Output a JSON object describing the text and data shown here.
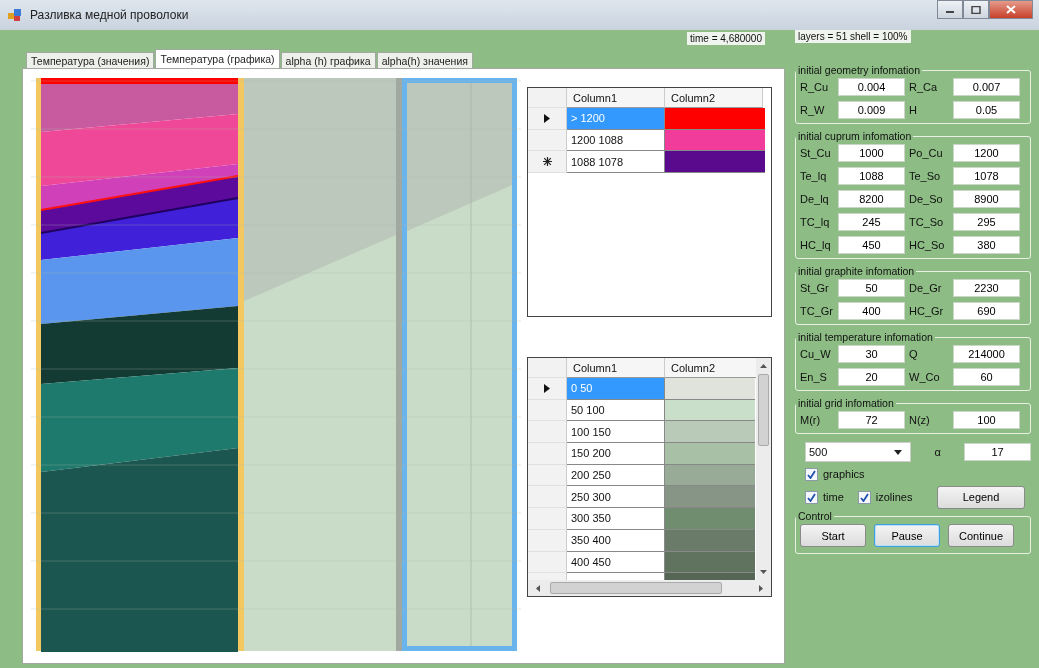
{
  "window": {
    "title": "Разливка медной проволоки"
  },
  "tabs": [
    {
      "label": "Температура (значения)",
      "selected": false
    },
    {
      "label": "Температура (графика)",
      "selected": true
    },
    {
      "label": "alpha (h) графика",
      "selected": false
    },
    {
      "label": "alpha(h) значения",
      "selected": false
    }
  ],
  "status": {
    "time": "time =  4,680000",
    "layers": "layers = 51 shell = 100%"
  },
  "legend_tables": [
    {
      "columns": [
        "Column1",
        "Column2"
      ],
      "scrollbars": false,
      "rows": [
        {
          "label": "> 1200",
          "color": "#ff0000",
          "selected": true,
          "current": true,
          "new_row": false
        },
        {
          "label": "1200 1088",
          "color": "#f23c9c",
          "selected": false,
          "current": false,
          "new_row": false
        },
        {
          "label": "1088 1078",
          "color": "#5a0a8c",
          "selected": false,
          "current": false,
          "new_row": true
        }
      ]
    },
    {
      "columns": [
        "Column1",
        "Column2"
      ],
      "scrollbars": true,
      "rows": [
        {
          "label": "0 50",
          "color": "#dfe3dc",
          "selected": true,
          "current": true,
          "new_row": false
        },
        {
          "label": "50 100",
          "color": "#cadfca",
          "selected": false,
          "current": false,
          "new_row": false
        },
        {
          "label": "100 150",
          "color": "#b9cbb8",
          "selected": false,
          "current": false,
          "new_row": false
        },
        {
          "label": "150 200",
          "color": "#a7c0a6",
          "selected": false,
          "current": false,
          "new_row": false
        },
        {
          "label": "200 250",
          "color": "#98ab97",
          "selected": false,
          "current": false,
          "new_row": false
        },
        {
          "label": "250 300",
          "color": "#869585",
          "selected": false,
          "current": false,
          "new_row": false
        },
        {
          "label": "300 350",
          "color": "#718d70",
          "selected": false,
          "current": false,
          "new_row": false
        },
        {
          "label": "350 400",
          "color": "#6a7b69",
          "selected": false,
          "current": false,
          "new_row": false
        },
        {
          "label": "400 450",
          "color": "#5f735e",
          "selected": false,
          "current": false,
          "new_row": false
        },
        {
          "color": "#566655",
          "selected": false
        }
      ]
    }
  ],
  "groups": [
    {
      "title": "initial geometry infomation",
      "fields": [
        {
          "label": "R_Cu",
          "value": "0.004"
        },
        {
          "label": "R_Ca",
          "value": "0.007"
        },
        {
          "label": "R_W",
          "value": "0.009"
        },
        {
          "label": "H",
          "value": "0.05"
        }
      ]
    },
    {
      "title": "initial cuprum infomation",
      "fields": [
        {
          "label": "St_Cu",
          "value": "1000"
        },
        {
          "label": "Po_Cu",
          "value": "1200"
        },
        {
          "label": "Te_lq",
          "value": "1088"
        },
        {
          "label": "Te_So",
          "value": "1078"
        },
        {
          "label": "De_lq",
          "value": "8200"
        },
        {
          "label": "De_So",
          "value": "8900"
        },
        {
          "label": "TC_lq",
          "value": "245"
        },
        {
          "label": "TC_So",
          "value": "295"
        },
        {
          "label": "HC_lq",
          "value": "450"
        },
        {
          "label": "HC_So",
          "value": "380"
        }
      ]
    },
    {
      "title": "initial graphite infomation",
      "fields": [
        {
          "label": "St_Gr",
          "value": "50"
        },
        {
          "label": "De_Gr",
          "value": "2230"
        },
        {
          "label": "TC_Gr",
          "value": "400"
        },
        {
          "label": "HC_Gr",
          "value": "690"
        }
      ]
    },
    {
      "title": "initial temperature infomation",
      "fields": [
        {
          "label": "Cu_W",
          "value": "30"
        },
        {
          "label": "Q",
          "value": "214000"
        },
        {
          "label": "En_S",
          "value": "20"
        },
        {
          "label": "W_Co",
          "value": "60"
        }
      ]
    },
    {
      "title": "initial grid infomation",
      "fields": [
        {
          "label": "M(r)",
          "value": "72"
        },
        {
          "label": "N(z)",
          "value": "100"
        }
      ]
    }
  ],
  "step": {
    "value": "500"
  },
  "alpha": {
    "label": "α",
    "value": "17"
  },
  "checkboxes": [
    {
      "label": "graphics",
      "checked": true
    },
    {
      "label": "time",
      "checked": true
    },
    {
      "label": "izolines",
      "checked": true
    }
  ],
  "legend_button": "Legend",
  "control_group": {
    "title": "Control",
    "buttons": [
      {
        "label": "Start",
        "focused": false
      },
      {
        "label": "Pause",
        "focused": true
      },
      {
        "label": "Continue",
        "focused": false
      }
    ]
  }
}
